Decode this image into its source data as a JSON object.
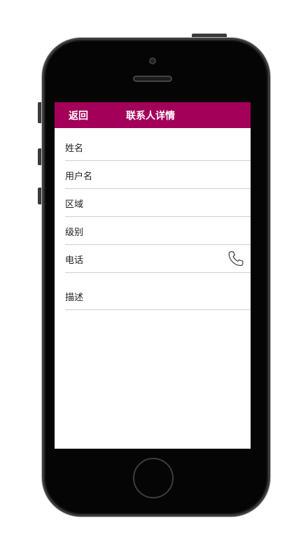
{
  "header": {
    "back_label": "返回",
    "title": "联系人详情"
  },
  "fields": [
    {
      "label": "姓名"
    },
    {
      "label": "用户名"
    },
    {
      "label": "区域"
    },
    {
      "label": "级别"
    },
    {
      "label": "电话",
      "icon": "phone-icon"
    },
    {
      "label": "描述"
    }
  ],
  "colors": {
    "header_bg": "#a3005a",
    "divider": "#cfcfcf"
  }
}
